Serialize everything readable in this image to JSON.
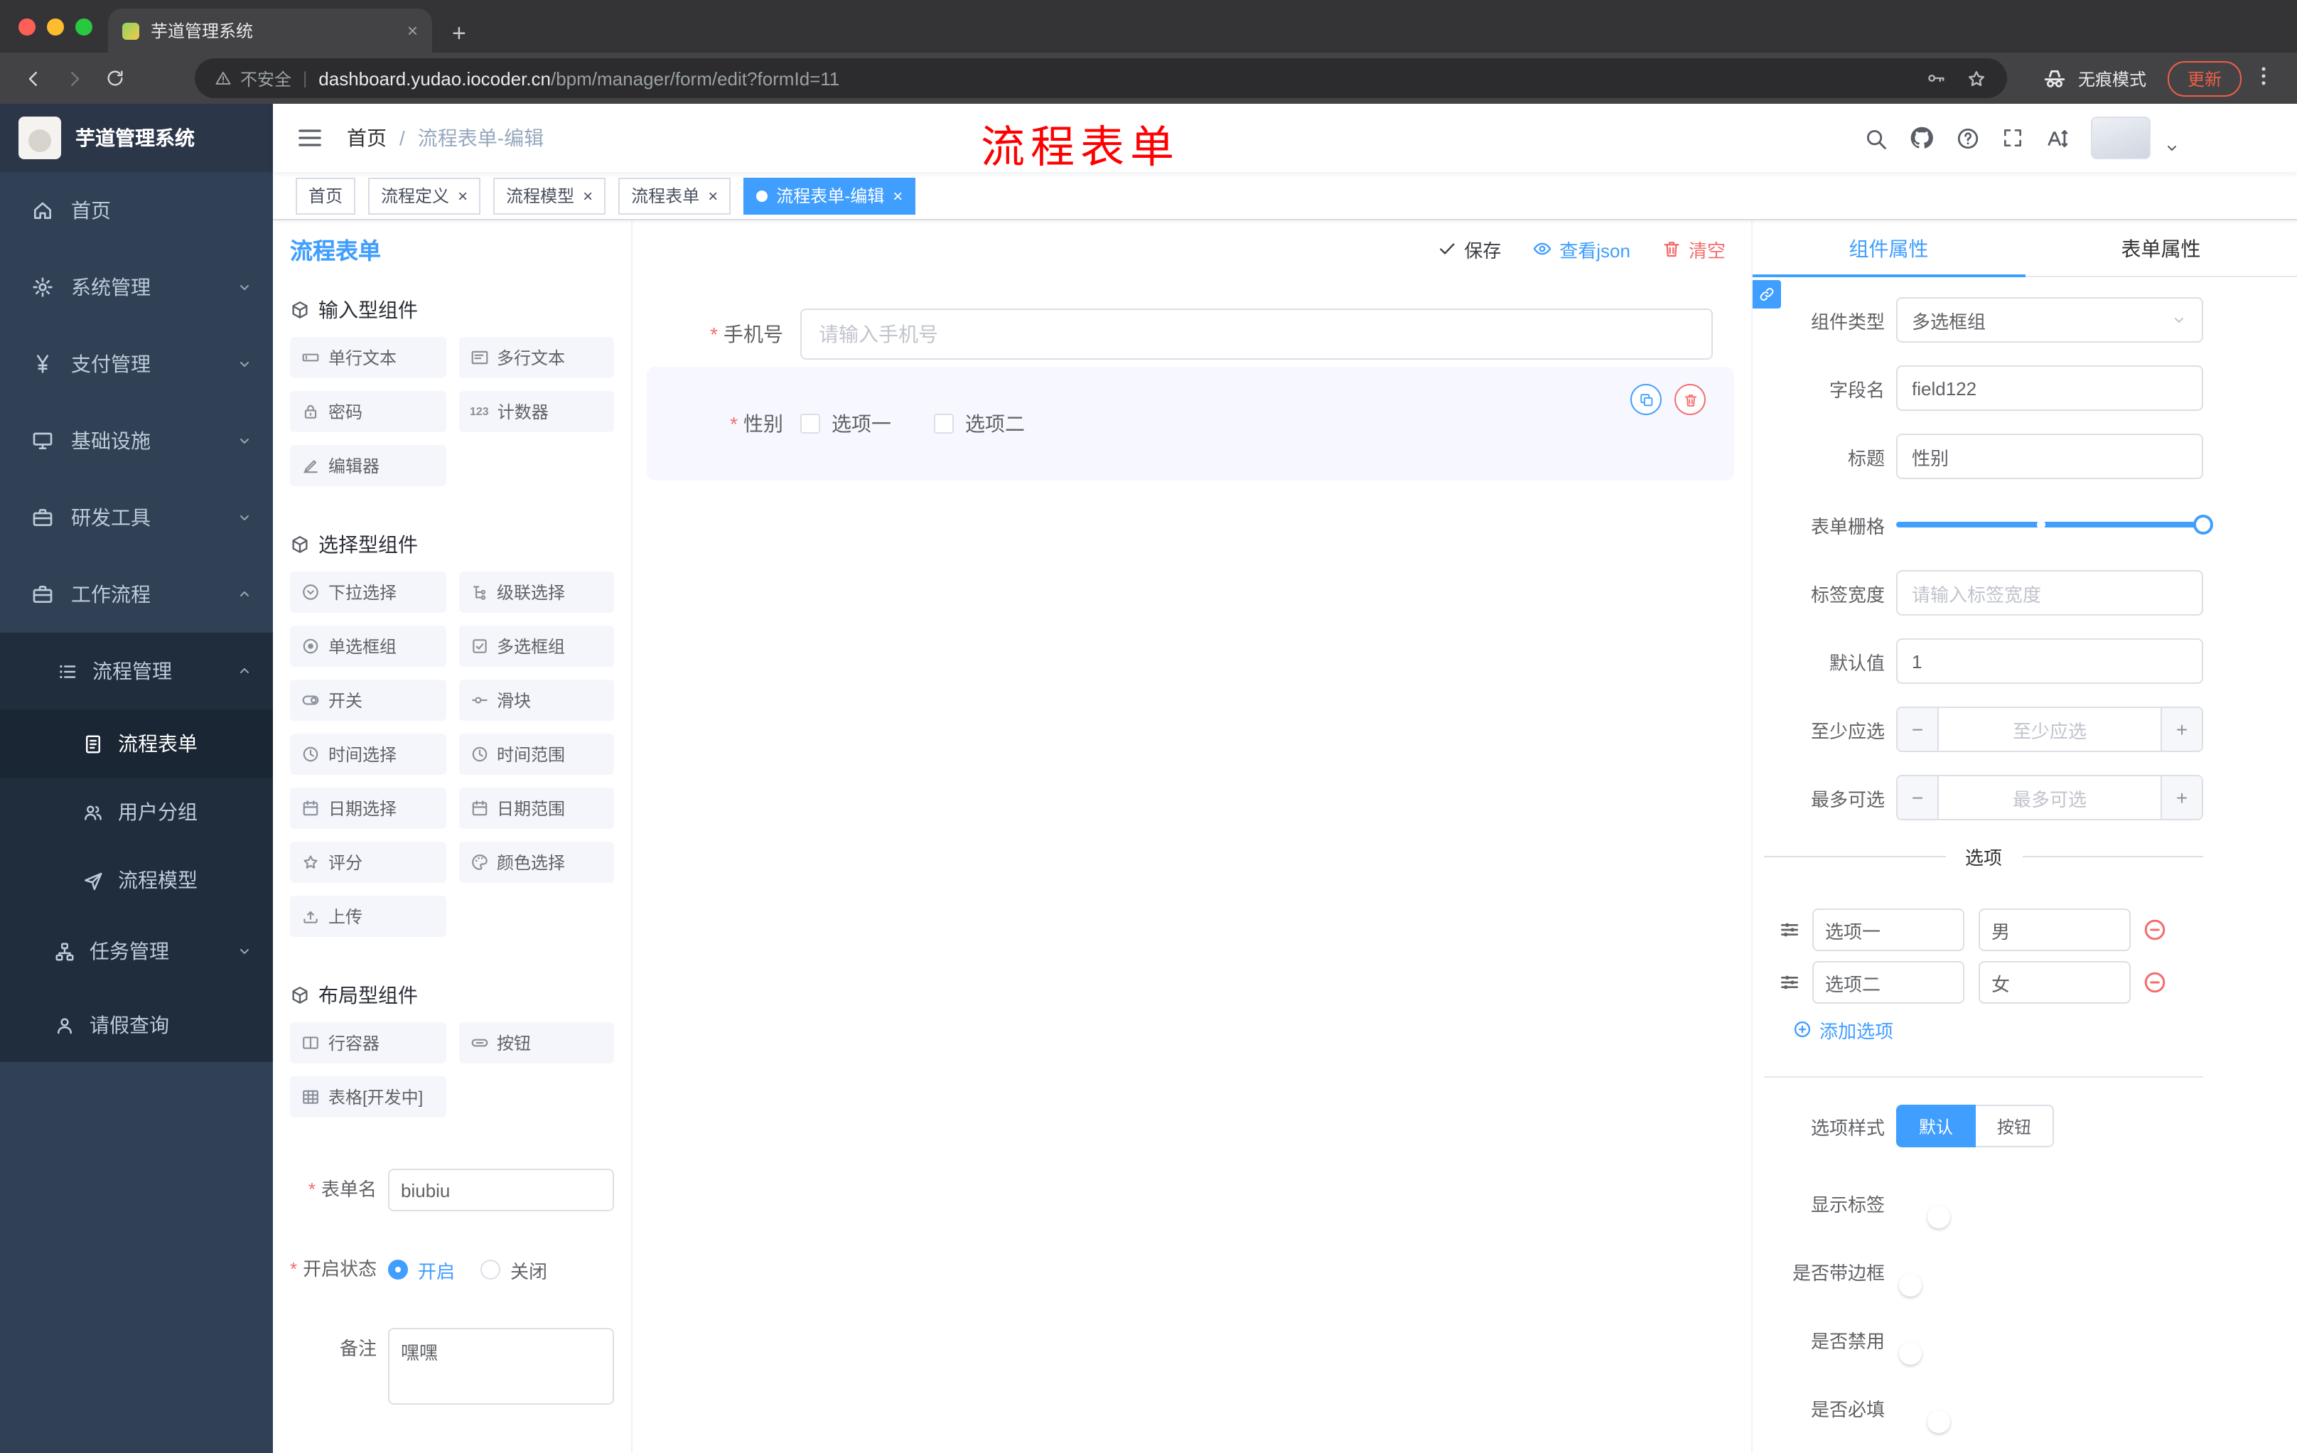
{
  "colors": {
    "primary": "#409eff",
    "danger": "#f56c6c",
    "annotation_red": "#ff0000",
    "sidebar_bg": "#304156",
    "sidebar_sub_bg": "#1f2d3d",
    "active_tag_bg": "#409eff"
  },
  "glyphs": {
    "close": "×",
    "plus": "+",
    "minus": "−",
    "divider": "|"
  },
  "browser": {
    "tab": {
      "title": "芋道管理系统"
    },
    "address": {
      "security": "不安全",
      "host": "dashboard.yudao.iocoder.cn",
      "path": "/bpm/manager/form/edit?formId=11"
    },
    "incognito_label": "无痕模式",
    "update_label": "更新"
  },
  "annotation": {
    "text": "流程表单"
  },
  "sidebar": {
    "logo_title": "芋道管理系统",
    "menu": [
      {
        "label": "首页"
      },
      {
        "label": "系统管理"
      },
      {
        "label": "支付管理"
      },
      {
        "label": "基础设施"
      },
      {
        "label": "研发工具"
      },
      {
        "label": "工作流程"
      }
    ],
    "process_group": {
      "label": "流程管理"
    },
    "process_children": [
      {
        "label": "流程表单",
        "active": true
      },
      {
        "label": "用户分组",
        "active": false
      },
      {
        "label": "流程模型",
        "active": false
      }
    ],
    "task_group": {
      "label": "任务管理"
    },
    "leave_item": {
      "label": "请假查询"
    }
  },
  "navbar": {
    "breadcrumb": {
      "home": "首页",
      "sep": "/",
      "current": "流程表单-编辑"
    }
  },
  "tags": [
    {
      "label": "首页",
      "closable": false,
      "active": false
    },
    {
      "label": "流程定义",
      "closable": true,
      "active": false
    },
    {
      "label": "流程模型",
      "closable": true,
      "active": false
    },
    {
      "label": "流程表单",
      "closable": true,
      "active": false
    },
    {
      "label": "流程表单-编辑",
      "closable": true,
      "active": true
    }
  ],
  "designer": {
    "title": "流程表单",
    "actions": {
      "save": "保存",
      "view_json": "查看json",
      "clear": "清空"
    },
    "palette": {
      "counter_glyph": "123",
      "groups": [
        {
          "title": "输入型组件",
          "items": [
            {
              "label": "单行文本"
            },
            {
              "label": "多行文本"
            },
            {
              "label": "密码"
            },
            {
              "label": "计数器"
            },
            {
              "label": "编辑器"
            }
          ]
        },
        {
          "title": "选择型组件",
          "items": [
            {
              "label": "下拉选择"
            },
            {
              "label": "级联选择"
            },
            {
              "label": "单选框组"
            },
            {
              "label": "多选框组"
            },
            {
              "label": "开关"
            },
            {
              "label": "滑块"
            },
            {
              "label": "时间选择"
            },
            {
              "label": "时间范围"
            },
            {
              "label": "日期选择"
            },
            {
              "label": "日期范围"
            },
            {
              "label": "评分"
            },
            {
              "label": "颜色选择"
            },
            {
              "label": "上传"
            }
          ]
        },
        {
          "title": "布局型组件",
          "items": [
            {
              "label": "行容器"
            },
            {
              "label": "按钮"
            },
            {
              "label": "表格[开发中]"
            }
          ]
        }
      ]
    },
    "meta": {
      "form_name": {
        "label": "表单名",
        "value": "biubiu",
        "required": true
      },
      "status": {
        "label": "开启状态",
        "on_label": "开启",
        "off_label": "关闭",
        "selected": "开启",
        "required": true
      },
      "remark": {
        "label": "备注",
        "value": "嘿嘿"
      }
    },
    "canvas": {
      "phone": {
        "label": "手机号",
        "placeholder": "请输入手机号",
        "required": true
      },
      "gender": {
        "label": "性别",
        "required": true,
        "selected": true,
        "options": [
          {
            "label": "选项一",
            "checked": false
          },
          {
            "label": "选项二",
            "checked": false
          }
        ]
      }
    }
  },
  "props": {
    "tabs": {
      "component": "组件属性",
      "form": "表单属性",
      "active": "组件属性"
    },
    "fields": {
      "component_type": {
        "label": "组件类型",
        "value": "多选框组"
      },
      "field_name": {
        "label": "字段名",
        "value": "field122"
      },
      "title": {
        "label": "标题",
        "value": "性别"
      },
      "form_grid": {
        "label": "表单栅格",
        "value": 24,
        "max": 24
      },
      "label_width": {
        "label": "标签宽度",
        "placeholder": "请输入标签宽度"
      },
      "default_value": {
        "label": "默认值",
        "value": "1"
      },
      "min_select": {
        "label": "至少应选",
        "placeholder": "至少应选"
      },
      "max_select": {
        "label": "最多可选",
        "placeholder": "最多可选"
      }
    },
    "options": {
      "divider": "选项",
      "rows": [
        {
          "label": "选项一",
          "value": "男"
        },
        {
          "label": "选项二",
          "value": "女"
        }
      ],
      "add_label": "添加选项"
    },
    "option_style": {
      "label": "选项样式",
      "choices": [
        "默认",
        "按钮"
      ],
      "selected": "默认"
    },
    "switches": [
      {
        "label": "显示标签",
        "on": true
      },
      {
        "label": "是否带边框",
        "on": false
      },
      {
        "label": "是否禁用",
        "on": false
      },
      {
        "label": "是否必填",
        "on": true
      }
    ]
  }
}
